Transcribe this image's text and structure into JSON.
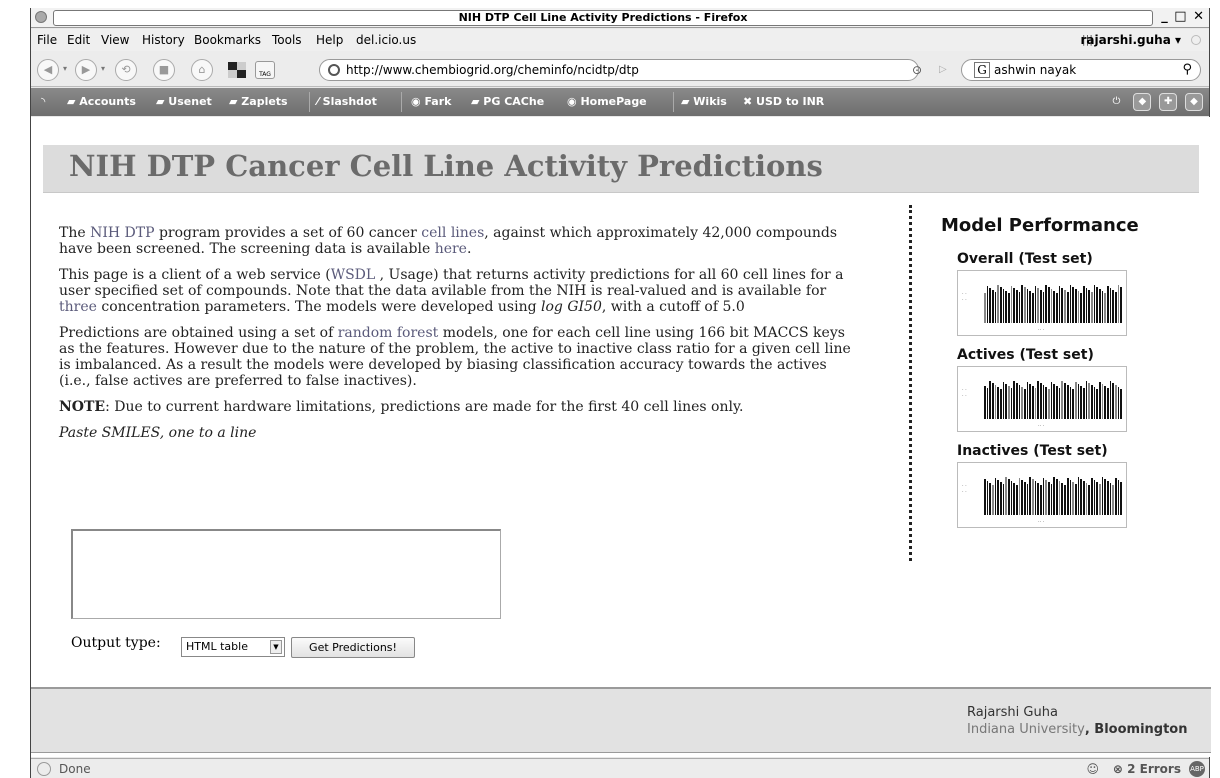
{
  "window": {
    "title": "NIH DTP Cell Line Activity Predictions - Firefox",
    "controls": "_ □ ✕"
  },
  "menubar": {
    "items": [
      "File",
      "Edit",
      "View",
      "History",
      "Bookmarks",
      "Tools",
      "Help",
      "del.icio.us"
    ],
    "user": "rajarshi.guha ▾"
  },
  "navbar": {
    "url": "http://www.chembiogrid.org/cheminfo/ncidtp/dtp",
    "search": "ashwin nayak",
    "tag_label": "TAG"
  },
  "bookmarks": [
    "Accounts",
    "Usenet",
    "Zaplets",
    "Slashdot",
    "Fark",
    "PG CAChe",
    "HomePage",
    "Wikis",
    "USD to INR"
  ],
  "page": {
    "title": "NIH DTP Cancer Cell Line Activity Predictions",
    "p1": {
      "t1": "The ",
      "l1": "NIH DTP",
      "t2": " program provides a set of 60 cancer ",
      "l2": "cell lines",
      "t3": ", against which approximately 42,000 compounds have been screened. The screening data is available ",
      "l3": "here",
      "t4": "."
    },
    "p2": {
      "t1": "This page is a client of a web service (",
      "l1": "WSDL",
      "t2": " , Usage) that returns activity predictions for all 60 cell lines for a user specified set of compounds. Note that the data avilable from the NIH is real-valued and is available for ",
      "l2": "three",
      "t3": " concentration parameters. The models were developed using ",
      "em": "log GI50",
      "t4": ", with a cutoff of 5.0"
    },
    "p3": {
      "t1": "Predictions are obtained using a set of ",
      "l1": "random forest",
      "t2": " models, one for each cell line using 166 bit MACCS keys as the features. However due to the nature of the problem, the active to inactive class ratio for a given cell line is imbalanced. As a result the models were developed by biasing classification accuracy towards the actives (i.e., false actives are preferred to false inactives)."
    },
    "note_label": "NOTE",
    "note_text": ": Due to current hardware limitations, predictions are made for the first 40 cell lines only.",
    "paste_label": "Paste SMILES, one to a line",
    "output_label": "Output type:",
    "output_selected": "HTML table",
    "submit_label": "Get Predictions!"
  },
  "sidebar": {
    "title": "Model Performance",
    "sections": [
      {
        "label": "Overall (Test set)"
      },
      {
        "label": "Actives (Test set)"
      },
      {
        "label": "Inactives (Test set)"
      }
    ]
  },
  "footer": {
    "name": "Rajarshi Guha",
    "aff_link": "Indiana University",
    "aff_rest": ", Bloomington"
  },
  "status": {
    "text": "Done",
    "errors": "2 Errors",
    "abp": "ABP"
  }
}
